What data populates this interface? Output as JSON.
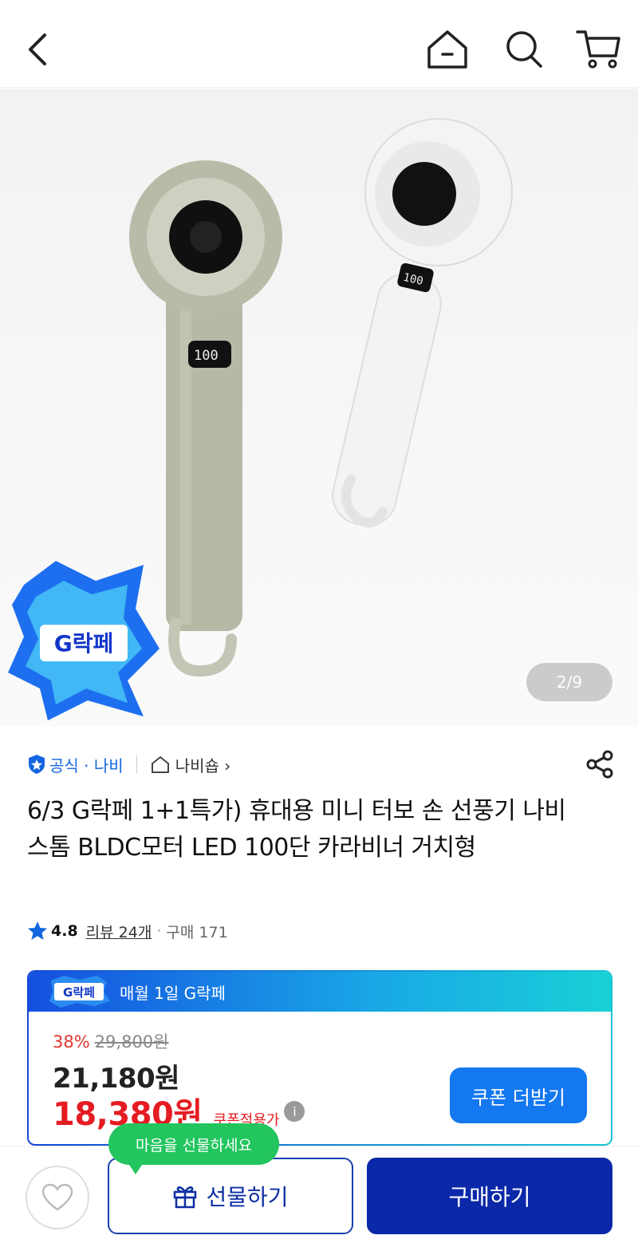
{
  "header": {
    "icons": [
      "chevron-left-icon",
      "home-icon",
      "search-icon",
      "cart-icon"
    ]
  },
  "hero": {
    "pager": "2/9",
    "badge_text": "G락페",
    "fan_display_left": "100",
    "fan_display_right": "100"
  },
  "seller": {
    "official": "공식 · 나비",
    "shop": "나비숍 ›"
  },
  "product": {
    "title": "6/3 G락페 1+1특가) 휴대용 미니 터보 손 선풍기 나비 스톰 BLDC모터 LED 100단 카라비너 거치형"
  },
  "rating": {
    "score": "4.8",
    "reviews": "리뷰 24개",
    "dot": "·",
    "purchases": "구매 171"
  },
  "price": {
    "band_logo": "G락페",
    "band_text": "매월 1일 G락페",
    "discount": "38%",
    "original": "29,800원",
    "sale": "21,180원",
    "coupon_price": "18,380원",
    "coupon_label": "쿠폰적용가",
    "info": "i",
    "more_coupon": "쿠폰 더받기"
  },
  "bottom": {
    "tooltip": "마음을 선물하세요",
    "gift": "선물하기",
    "buy": "구매하기"
  },
  "colors": {
    "brand_blue": "#0a28a8",
    "coupon_red": "#e51c23",
    "accent_blue": "#1478f0",
    "tooltip_green": "#22c55e"
  }
}
